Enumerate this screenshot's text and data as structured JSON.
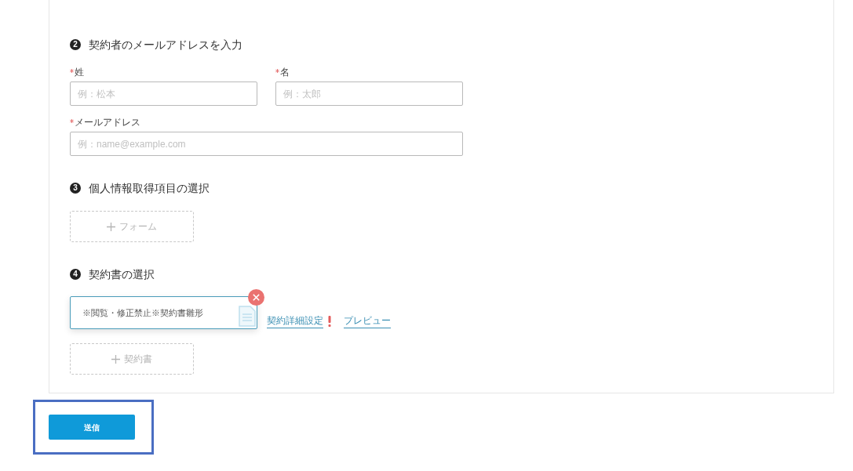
{
  "sections": [
    {
      "kind": "inputs",
      "number": "2",
      "title": "契約者のメールアドレスを入力",
      "rows": [
        [
          {
            "label": "姓",
            "required": true,
            "placeholder": "例：松本"
          },
          {
            "label": "名",
            "required": true,
            "placeholder": "例：太郎"
          }
        ],
        [
          {
            "label": "メールアドレス",
            "required": true,
            "placeholder": "例：name@example.com"
          }
        ]
      ]
    },
    {
      "kind": "add",
      "number": "3",
      "title": "個人情報取得項目の選択",
      "add_button": {
        "label": "フォーム"
      }
    },
    {
      "kind": "contracts",
      "number": "4",
      "title": "契約書の選択",
      "contracts": [
        {
          "name": "※閲覧・修正禁止※契約書雛形",
          "settings_link": "契約詳細設定",
          "warning": true,
          "preview_link": "プレビュー"
        }
      ],
      "add_button": {
        "label": "契約書"
      }
    }
  ],
  "submit": {
    "label": "送信",
    "highlighted": true
  }
}
